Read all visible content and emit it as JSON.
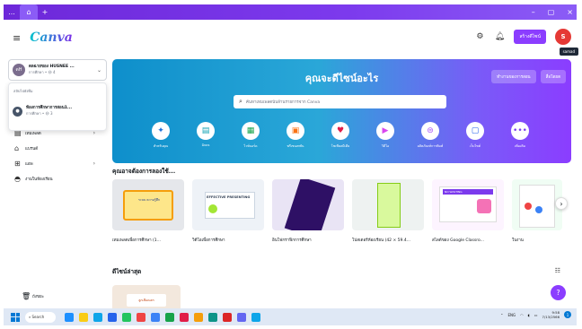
{
  "browser": {
    "menu": "...",
    "home_tab": "⌂",
    "new_tab": "+",
    "controls": [
      "–",
      "▢",
      "×"
    ]
  },
  "app": {
    "logo": "Canva",
    "create_button": "สร้างดีไซน์",
    "avatar_initial": "S",
    "tooltip": "samad"
  },
  "sidebar": {
    "account": {
      "initials": "ดH",
      "name": "ดลฉายของ HUSNEE ...",
      "sub": "การศึกษา • 😃 4"
    },
    "dropdown": {
      "label": "สลับไปยังทีม",
      "item_name": "ห้องการศึกษาการสอน1...",
      "item_sub": "การศึกษา • 😃 3"
    },
    "nav": [
      {
        "icon": "▤",
        "label": "เทมเพลต",
        "arrow": "›"
      },
      {
        "icon": "⌂",
        "label": "แบรนด์",
        "arrow": ""
      },
      {
        "icon": "⊞",
        "label": "แอพ",
        "arrow": "›"
      },
      {
        "icon": "◓",
        "label": "งานในห้องเรียน",
        "arrow": ""
      }
    ],
    "trash": "ถังขยะ"
  },
  "hero": {
    "title": "คุณจะดีไซน์อะไร",
    "buttons": [
      "ทำงานของการสอน",
      "สื่อโดยต"
    ],
    "search_placeholder": "ค้นหาเทมเพลตนับล้านรายการจาก Canva",
    "categories": [
      {
        "label": "สำหรับคุณ",
        "icon": "✦",
        "color": "#1e6fd9"
      },
      {
        "label": "Docs",
        "icon": "▤",
        "color": "#13a3b5"
      },
      {
        "label": "ไวท์บอร์ด",
        "icon": "▦",
        "color": "#16a34a"
      },
      {
        "label": "พรีเซนเทชัน",
        "icon": "▣",
        "color": "#f97316"
      },
      {
        "label": "โซเชียลมีเดีย",
        "icon": "♥",
        "color": "#e11d48"
      },
      {
        "label": "วิดีโอ",
        "icon": "▶",
        "color": "#d946ef"
      },
      {
        "label": "ผลิตภัณฑ์การพิมพ์",
        "icon": "⊜",
        "color": "#a855f7"
      },
      {
        "label": "เว็บไซต์",
        "icon": "▢",
        "color": "#2563eb"
      },
      {
        "label": "เพิ่มเติม",
        "icon": "•••",
        "color": "#7c3aed"
      }
    ]
  },
  "suggestions": {
    "title": "คุณอาจต้องการลองใช้...",
    "items": [
      {
        "label": "เทมเพลตเพื่อการศึกษา (1...",
        "thumb_text": "ระบบ ความรู้สึก"
      },
      {
        "label": "วิดีโอเพื่อการศึกษา",
        "thumb_text": "EFFECTIVE PRESENTING"
      },
      {
        "label": "อินโฟกราฟิกการศึกษา",
        "thumb_text": ""
      },
      {
        "label": "โปสเตอร์ห้องเรียน (42 × 59.4...",
        "thumb_text": ""
      },
      {
        "label": "สไลด์ของ Google Classro...",
        "thumb_text": "NO WASTING"
      },
      {
        "label": "ใบงาน",
        "thumb_text": ""
      }
    ]
  },
  "recent": {
    "title": "ดีไซน์ล่าสุด",
    "thumb_text": "ลูกเสือเนตร"
  },
  "help": "?",
  "taskbar": {
    "search": "Search",
    "lang": "ENG",
    "time": "9:58",
    "date": "7/13/2566",
    "notif": "1",
    "apps": [
      "#1e90ff",
      "#facc15",
      "#0ea5e9",
      "#2563eb",
      "#22c55e",
      "#ef4444",
      "#3b82f6",
      "#16a34a",
      "#e11d48",
      "#f59e0b",
      "#0d9488",
      "#dc2626",
      "#6366f1",
      "#0ea5e9"
    ]
  }
}
